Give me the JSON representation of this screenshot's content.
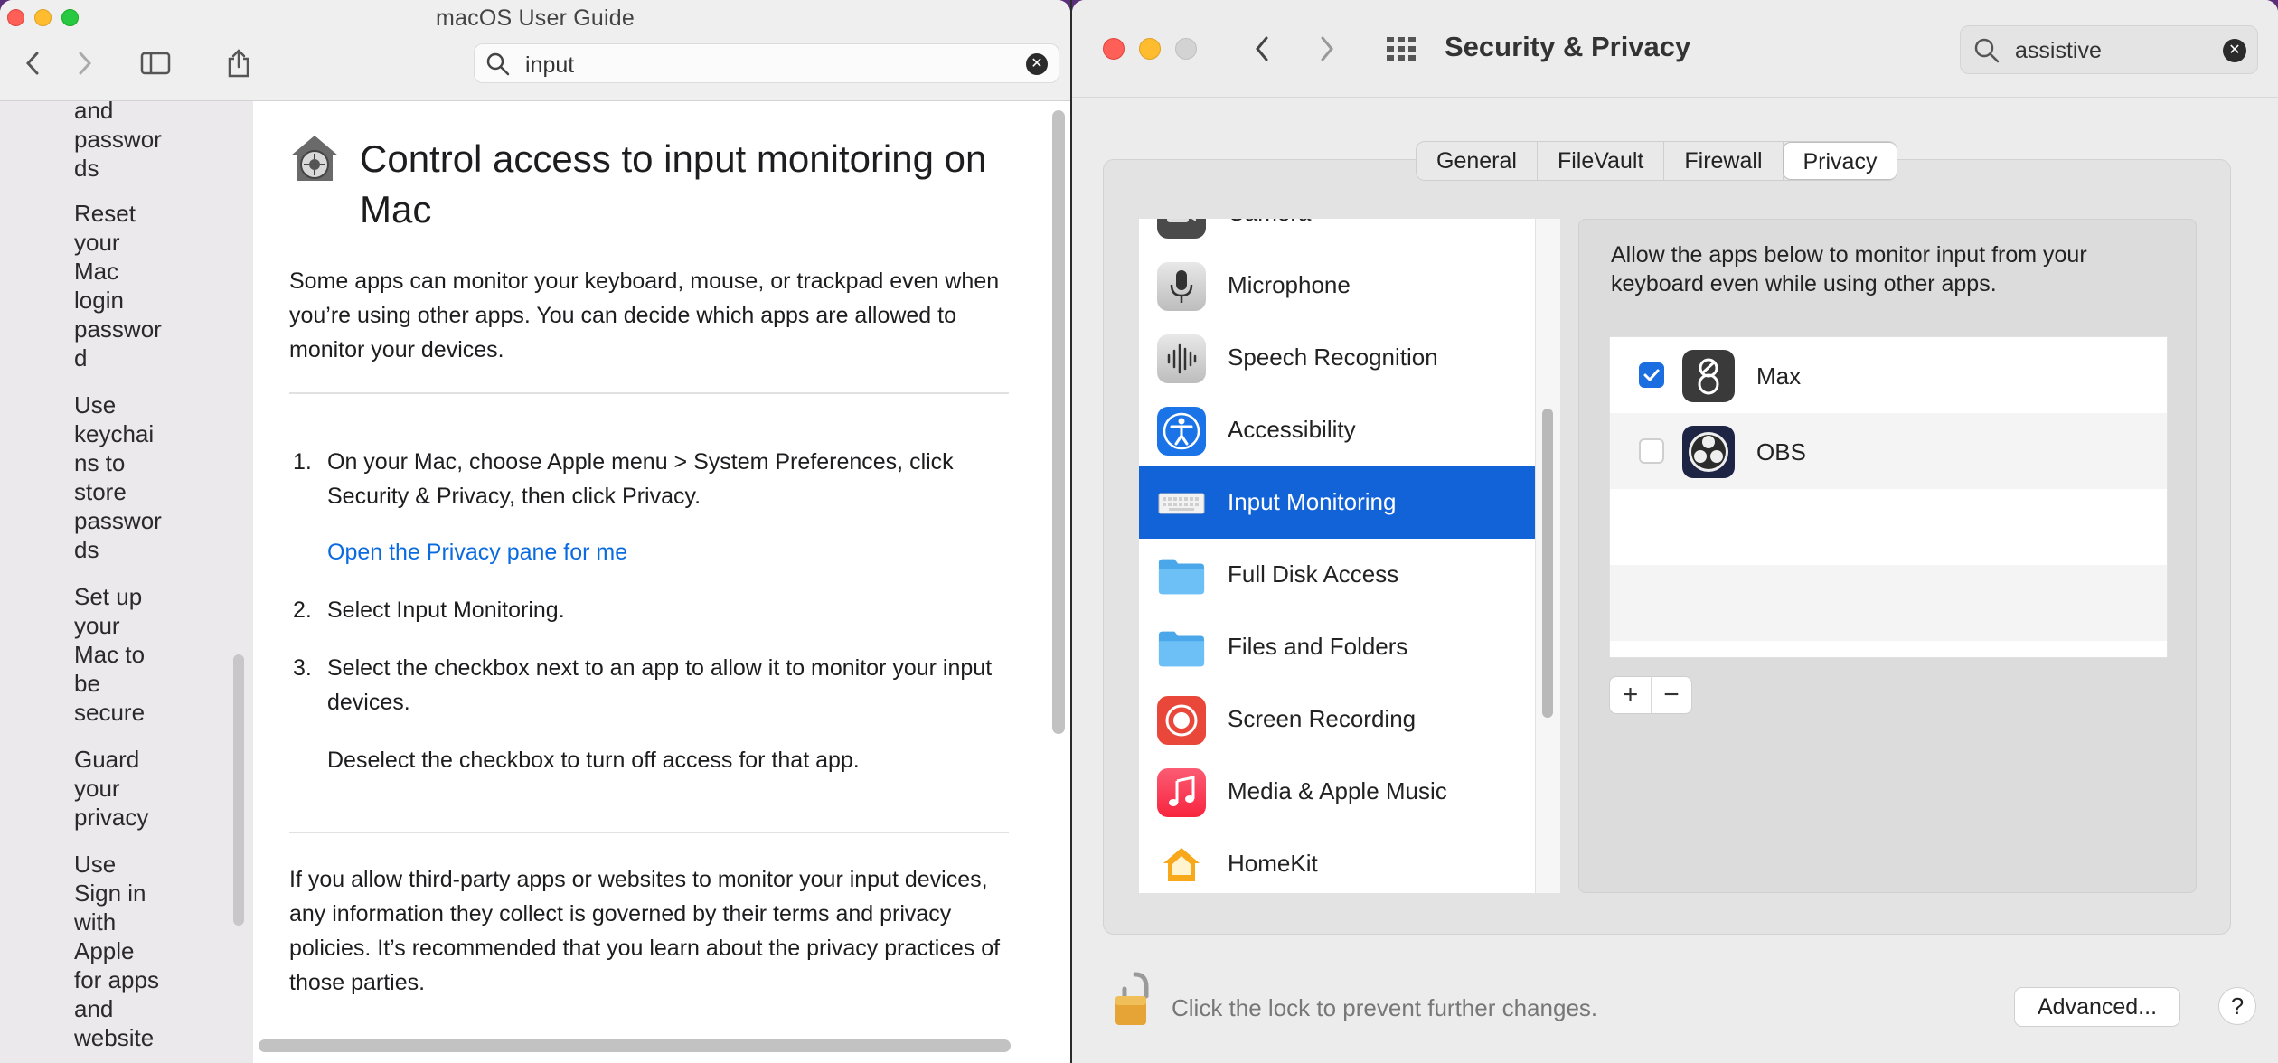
{
  "guide": {
    "window_title": "macOS User Guide",
    "search": {
      "value": "input"
    },
    "sidebar": [
      {
        "label": "and\npasswor\nds"
      },
      {
        "label": "Reset\nyour\nMac\nlogin\npasswor\nd"
      },
      {
        "label": "Use\nkeychai\nns to\nstore\npasswor\nds"
      },
      {
        "label": "Set up\nyour\nMac to\nbe\nsecure"
      },
      {
        "label": "Guard\nyour\nprivacy"
      },
      {
        "label": "Use\nSign in\nwith\nApple\nfor apps\nand\nwebsite"
      }
    ],
    "article": {
      "title": "Control access to input monitoring on Mac",
      "intro": "Some apps can monitor your keyboard, mouse, or trackpad even when you’re using other apps. You can decide which apps are allowed to monitor your devices.",
      "steps": [
        {
          "num": "1.",
          "text": "On your Mac, choose Apple menu  > System Preferences, click Security & Privacy, then click Privacy."
        },
        {
          "num": "2.",
          "text": "Select Input Monitoring."
        },
        {
          "num": "3.",
          "text": "Select the checkbox next to an app to allow it to monitor your input devices."
        }
      ],
      "link": "Open the Privacy pane for me",
      "deselect_note": "Deselect the checkbox to turn off access for that app.",
      "footer": "If you allow third-party apps or websites to monitor your input devices, any information they collect is governed by their terms and privacy policies. It’s recommended that you learn about the privacy practices of those parties."
    }
  },
  "prefs": {
    "window_title": "Security & Privacy",
    "search": {
      "value": "assistive"
    },
    "tabs": [
      "General",
      "FileVault",
      "Firewall",
      "Privacy"
    ],
    "active_tab": "Privacy",
    "categories": [
      {
        "label": "Camera",
        "icon": "camera-icon"
      },
      {
        "label": "Microphone",
        "icon": "microphone-icon"
      },
      {
        "label": "Speech Recognition",
        "icon": "speech-recognition-icon"
      },
      {
        "label": "Accessibility",
        "icon": "accessibility-icon"
      },
      {
        "label": "Input Monitoring",
        "icon": "keyboard-icon",
        "selected": true
      },
      {
        "label": "Full Disk Access",
        "icon": "folder-icon"
      },
      {
        "label": "Files and Folders",
        "icon": "folder-icon"
      },
      {
        "label": "Screen Recording",
        "icon": "screen-recording-icon"
      },
      {
        "label": "Media & Apple Music",
        "icon": "music-icon"
      },
      {
        "label": "HomeKit",
        "icon": "homekit-icon"
      }
    ],
    "description": "Allow the apps below to monitor input from your keyboard even while using other apps.",
    "apps": [
      {
        "name": "Max",
        "checked": true,
        "icon": "max-app-icon"
      },
      {
        "name": "OBS",
        "checked": false,
        "icon": "obs-app-icon"
      }
    ],
    "add_label": "+",
    "remove_label": "−",
    "lock_text": "Click the lock to prevent further changes.",
    "advanced_label": "Advanced...",
    "help_label": "?"
  },
  "colors": {
    "selection_blue": "#1363d8",
    "link_blue": "#0a6be0",
    "checkbox_blue": "#1a6ee0"
  }
}
